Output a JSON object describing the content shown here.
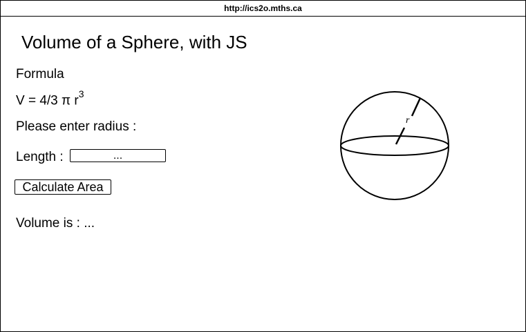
{
  "browser": {
    "url": "http://ics2o.mths.ca"
  },
  "page": {
    "title": "Volume of a Sphere, with JS",
    "formula_label": "Formula",
    "formula_text": "V = 4/3 π r",
    "formula_exponent": "3",
    "prompt": "Please enter radius :",
    "length_label": "Length :",
    "length_placeholder": "...",
    "calculate_label": "Calculate Area",
    "result_label": "Volume is :",
    "result_value": "..."
  },
  "figure": {
    "radius_label": "r",
    "icon": "sphere-diagram"
  }
}
